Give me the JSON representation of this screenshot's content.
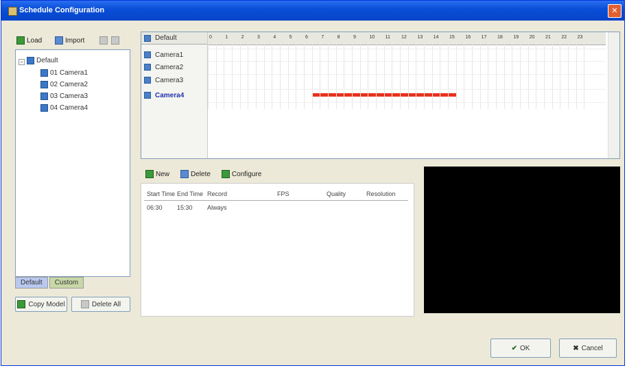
{
  "window": {
    "title": "Schedule Configuration",
    "close_icon": "close-icon"
  },
  "tree_toolbar": {
    "load_label": "Load",
    "import_label": "Import"
  },
  "tree": {
    "root_label": "Default",
    "items": [
      "01 Camera1",
      "02 Camera2",
      "03 Camera3",
      "04 Camera4"
    ]
  },
  "tabs": {
    "default_label": "Default",
    "custom_label": "Custom"
  },
  "left_buttons": {
    "copy_label": "Copy Model",
    "delete_label": "Delete All"
  },
  "schedule": {
    "header_label": "Default",
    "rows": [
      "Camera1",
      "Camera2",
      "Camera3",
      "Camera4"
    ],
    "selected_row": 3,
    "hours": [
      "0",
      "1",
      "2",
      "3",
      "4",
      "5",
      "6",
      "7",
      "8",
      "9",
      "10",
      "11",
      "12",
      "13",
      "14",
      "15",
      "16",
      "17",
      "18",
      "19",
      "20",
      "21",
      "22",
      "23"
    ],
    "bar": {
      "row": 3,
      "start_hour": 6.5,
      "end_hour": 15.5,
      "color": "#e8321e"
    }
  },
  "lower_toolbar": {
    "new_label": "New",
    "delete_label": "Delete",
    "configure_label": "Configure"
  },
  "list": {
    "columns": [
      "Start Time",
      "End Time",
      "Record",
      "FPS",
      "Quality",
      "Resolution"
    ],
    "rows": [
      [
        "06:30",
        "15:30",
        "Always",
        "",
        "",
        ""
      ]
    ]
  },
  "buttons": {
    "ok_label": "OK",
    "cancel_label": "Cancel"
  }
}
